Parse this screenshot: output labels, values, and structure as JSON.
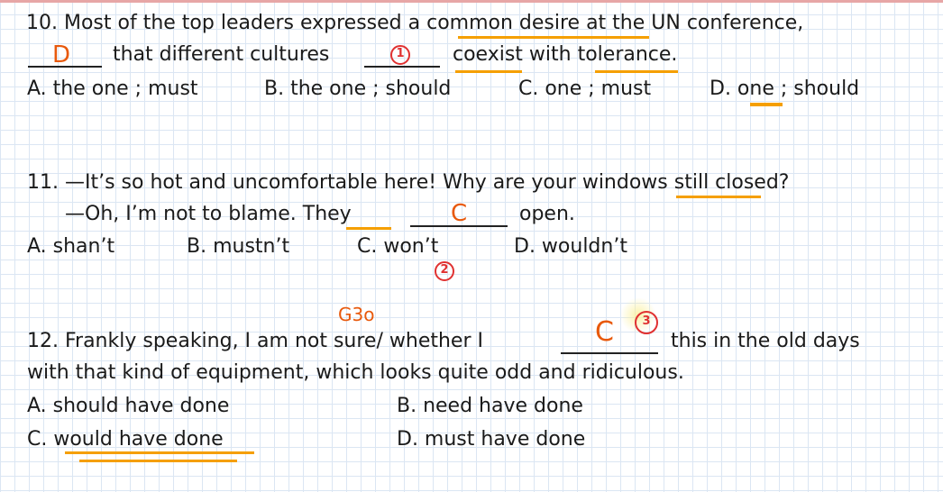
{
  "q10": {
    "line1": "10. Most of the top leaders expressed a common desire at the UN conference,",
    "line2_mid": "that different cultures",
    "line2_end": "coexist with tolerance.",
    "blank1_answer": "D",
    "blank2_mark": "1",
    "options": {
      "a": "A. the one ; must",
      "b": "B. the one ; should",
      "c": "C. one ; must",
      "d": "D. one ; should"
    }
  },
  "q11": {
    "line1": "11. —It’s so hot and uncomfortable here! Why are your windows still closed?",
    "line2_start": "—Oh, I’m not to blame. They",
    "line2_end": "open.",
    "blank_answer": "C",
    "mark": "2",
    "options": {
      "a": "A. shan’t",
      "b": "B. mustn’t",
      "c": "C. won’t",
      "d": "D. wouldn’t"
    }
  },
  "q12": {
    "note": "G3o",
    "line1_start": "12. Frankly speaking, I am not sure/ whether I",
    "line1_end": "this in the old days",
    "line2": "with that kind of equipment, which looks quite odd and ridiculous.",
    "blank_answer": "C",
    "mark": "3",
    "options": {
      "a": "A. should have done",
      "b": "B. need have done",
      "c": "C. would have done",
      "d": "D. must have done"
    }
  },
  "colors": {
    "annotation_orange": "#e8590c",
    "annotation_red": "#e03131",
    "underline_orange": "#f59f00",
    "grid": "#dbe6f3"
  }
}
